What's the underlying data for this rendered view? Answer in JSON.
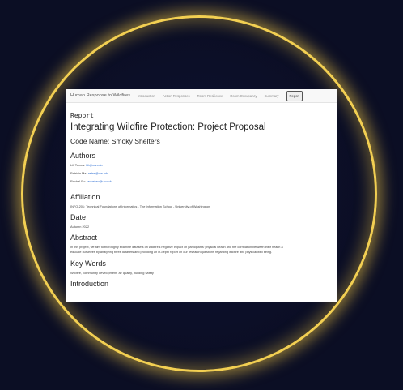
{
  "nav": {
    "brand": "Human Response to Wildfires",
    "items": [
      "Introduction",
      "Action Responses",
      "Room Resilience",
      "Room Occupancy",
      "Summary"
    ],
    "active": "Report"
  },
  "page": {
    "kicker": "Report",
    "title": "Integrating Wildfire Protection: Project Proposal",
    "code_name": "Code Name: Smoky Shelters"
  },
  "authors": {
    "heading": "Authors",
    "list": [
      {
        "name": "Lili Tomes:",
        "email": "ltlt@uw.edu"
      },
      {
        "name": "Patricia Ma:",
        "email": "astrw@uw.edu"
      },
      {
        "name": "Rachel Fu:",
        "email": "rachelnw@uw.edu"
      }
    ]
  },
  "affiliation": {
    "heading": "Affiliation",
    "text": "INFO-201: Technical Foundations of Informatics - The Information School - University of Washington"
  },
  "date": {
    "heading": "Date",
    "text": "Autumn 2022"
  },
  "abstract": {
    "heading": "Abstract",
    "line1": "In this project, we aim to thoroughly examine datasets on wildfire’s negative impact on participants’ physical health and the correlation between their health a",
    "line2": "educate ourselves by analyzing three datasets and providing an in-depth report on our research questions regarding wildfire and physical well being."
  },
  "keywords": {
    "heading": "Key Words",
    "text": "Wildfire, community development, air quality, building safety"
  },
  "introduction": {
    "heading": "Introduction"
  }
}
